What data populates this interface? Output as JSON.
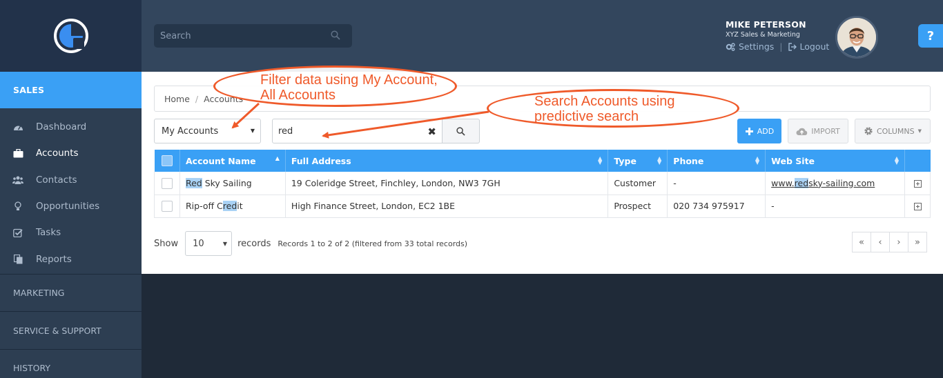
{
  "sidebar": {
    "section_title": "SALES",
    "items": [
      {
        "label": "Dashboard",
        "icon": "dashboard-icon"
      },
      {
        "label": "Accounts",
        "icon": "briefcase-icon",
        "active": true
      },
      {
        "label": "Contacts",
        "icon": "users-icon"
      },
      {
        "label": "Opportunities",
        "icon": "lightbulb-icon"
      },
      {
        "label": "Tasks",
        "icon": "check-square-icon"
      },
      {
        "label": "Reports",
        "icon": "copy-icon"
      }
    ],
    "sections": [
      "MARKETING",
      "SERVICE & SUPPORT",
      "HISTORY"
    ]
  },
  "topbar": {
    "search_placeholder": "Search",
    "user_name": "MIKE PETERSON",
    "user_company": "XYZ Sales & Marketing",
    "settings_label": "Settings",
    "logout_label": "Logout",
    "link_separator": "|",
    "help_label": "?"
  },
  "breadcrumb": {
    "home": "Home",
    "separator": "/",
    "current": "Accounts"
  },
  "filter": {
    "selected": "My Accounts",
    "search_value": "red"
  },
  "actions": {
    "add": "ADD",
    "import": "IMPORT",
    "columns": "COLUMNS"
  },
  "table": {
    "columns": [
      "Account Name",
      "Full Address",
      "Type",
      "Phone",
      "Web Site"
    ],
    "rows": [
      {
        "name_pre": "",
        "name_hl": "Red",
        "name_post": " Sky Sailing",
        "address": "19 Coleridge Street, Finchley, London, NW3 7GH",
        "type": "Customer",
        "phone": "-",
        "web_pre": "www.",
        "web_hl": "red",
        "web_post": "sky-sailing.com"
      },
      {
        "name_pre": "Rip-off C",
        "name_hl": "red",
        "name_post": "it",
        "address": "High Finance Street, London, EC2 1BE",
        "type": "Prospect",
        "phone": "020 734 975917",
        "web": "-"
      }
    ]
  },
  "footer": {
    "show_label": "Show",
    "page_size": "10",
    "records_label": "records",
    "records_info": "Records 1 to 2 of 2 (filtered from 33 total records)",
    "pager": [
      "«",
      "‹",
      "›",
      "»"
    ]
  },
  "annotations": {
    "filter_note": "Filter data using My Account, All Accounts",
    "search_note": "Search Accounts using predictive search"
  },
  "colors": {
    "accent": "#3aa0f5",
    "sidebar_bg": "#2d3e52",
    "topbar_bg": "#33465d",
    "callout": "#ef5a2a"
  }
}
